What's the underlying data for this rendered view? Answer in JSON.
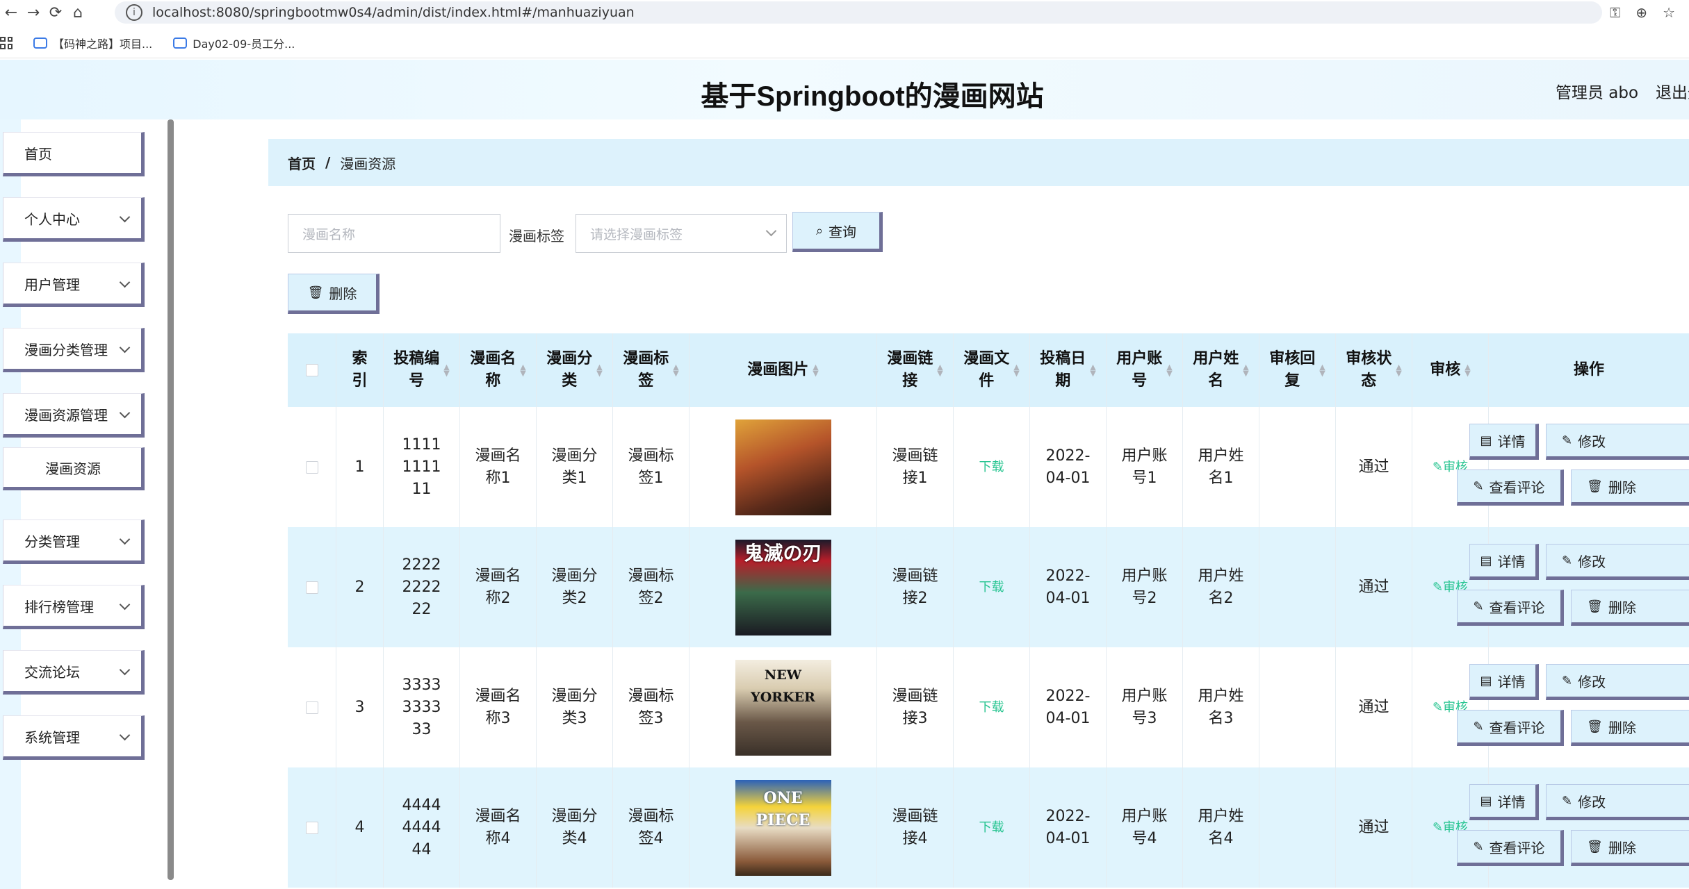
{
  "browser": {
    "url": "localhost:8080/springbootmw0s4/admin/dist/index.html#/manhuaziyuan",
    "bookmarks": [
      "【码神之路】项目...",
      "Day02-09-员工分..."
    ]
  },
  "header": {
    "title": "基于Springboot的漫画网站",
    "admin": "管理员 abo",
    "logout": "退出登录"
  },
  "sidebar": {
    "items": [
      {
        "label": "首页"
      },
      {
        "label": "个人中心"
      },
      {
        "label": "用户管理"
      },
      {
        "label": "漫画分类管理"
      },
      {
        "label": "漫画资源管理"
      },
      {
        "label": "漫画资源"
      },
      {
        "label": "分类管理"
      },
      {
        "label": "排行榜管理"
      },
      {
        "label": "交流论坛"
      },
      {
        "label": "系统管理"
      }
    ]
  },
  "breadcrumb": {
    "home": "首页",
    "sep": "/",
    "current": "漫画资源"
  },
  "search": {
    "name_placeholder": "漫画名称",
    "tag_label": "漫画标签",
    "tag_placeholder": "请选择漫画标签",
    "query_label": "查询"
  },
  "toolbar": {
    "delete_label": "删除"
  },
  "table": {
    "headers": {
      "index": "索引",
      "code": "投稿编号",
      "name": "漫画名称",
      "category": "漫画分类",
      "tag": "漫画标签",
      "image": "漫画图片",
      "link": "漫画链接",
      "file": "漫画文件",
      "date": "投稿日期",
      "account": "用户账号",
      "username": "用户姓名",
      "reply": "审核回复",
      "status": "审核状态",
      "audit": "审核",
      "actions": "操作"
    },
    "rows": [
      {
        "index": "1",
        "code": "1111111111",
        "name": "漫画名称1",
        "category": "漫画分类1",
        "tag": "漫画标签1",
        "link": "漫画链接1",
        "file": "下载",
        "date": "2022-04-01",
        "account": "用户账号1",
        "username": "用户姓名1",
        "reply": "",
        "status": "通过",
        "audit": "审核"
      },
      {
        "index": "2",
        "code": "2222222222",
        "name": "漫画名称2",
        "category": "漫画分类2",
        "tag": "漫画标签2",
        "link": "漫画链接2",
        "file": "下载",
        "date": "2022-04-01",
        "account": "用户账号2",
        "username": "用户姓名2",
        "reply": "",
        "status": "通过",
        "audit": "审核"
      },
      {
        "index": "3",
        "code": "3333333333",
        "name": "漫画名称3",
        "category": "漫画分类3",
        "tag": "漫画标签3",
        "link": "漫画链接3",
        "file": "下载",
        "date": "2022-04-01",
        "account": "用户账号3",
        "username": "用户姓名3",
        "reply": "",
        "status": "通过",
        "audit": "审核"
      },
      {
        "index": "4",
        "code": "4444444444",
        "name": "漫画名称4",
        "category": "漫画分类4",
        "tag": "漫画标签4",
        "link": "漫画链接4",
        "file": "下载",
        "date": "2022-04-01",
        "account": "用户账号4",
        "username": "用户姓名4",
        "reply": "",
        "status": "通过",
        "audit": "审核"
      }
    ],
    "covers": [
      "NEW YORKER",
      "ONE PIECE",
      "鬼滅の刃"
    ],
    "actions": {
      "detail": "详情",
      "edit": "修改",
      "comments": "查看评论",
      "delete": "删除"
    }
  },
  "colors": {
    "accent": "#ddf2fc",
    "shadow": "#6f6f97",
    "success": "#26c490"
  }
}
